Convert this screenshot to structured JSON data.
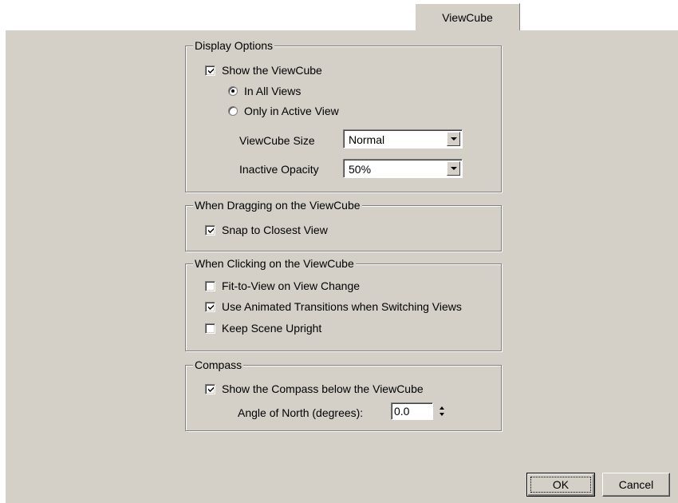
{
  "tab": {
    "label": "ViewCube"
  },
  "display_options": {
    "legend": "Display Options",
    "show_viewcube": {
      "label": "Show the ViewCube",
      "checked": true
    },
    "in_all_views": {
      "label": "In All Views",
      "selected": true
    },
    "only_active_view": {
      "label": "Only in Active View",
      "selected": false
    },
    "size": {
      "label": "ViewCube Size",
      "value": "Normal"
    },
    "opacity": {
      "label": "Inactive Opacity",
      "value": "50%"
    }
  },
  "dragging": {
    "legend": "When Dragging on the ViewCube",
    "snap": {
      "label": "Snap to Closest View",
      "checked": true
    }
  },
  "clicking": {
    "legend": "When Clicking on the ViewCube",
    "fit_to_view": {
      "label": "Fit-to-View on View Change",
      "checked": false
    },
    "animated": {
      "label": "Use Animated Transitions when Switching Views",
      "checked": true
    },
    "upright": {
      "label": "Keep Scene Upright",
      "checked": false
    }
  },
  "compass": {
    "legend": "Compass",
    "show_compass": {
      "label": "Show the Compass below the ViewCube",
      "checked": true
    },
    "angle": {
      "label": "Angle of North (degrees):",
      "value": "0.0"
    }
  },
  "buttons": {
    "ok": "OK",
    "cancel": "Cancel"
  }
}
